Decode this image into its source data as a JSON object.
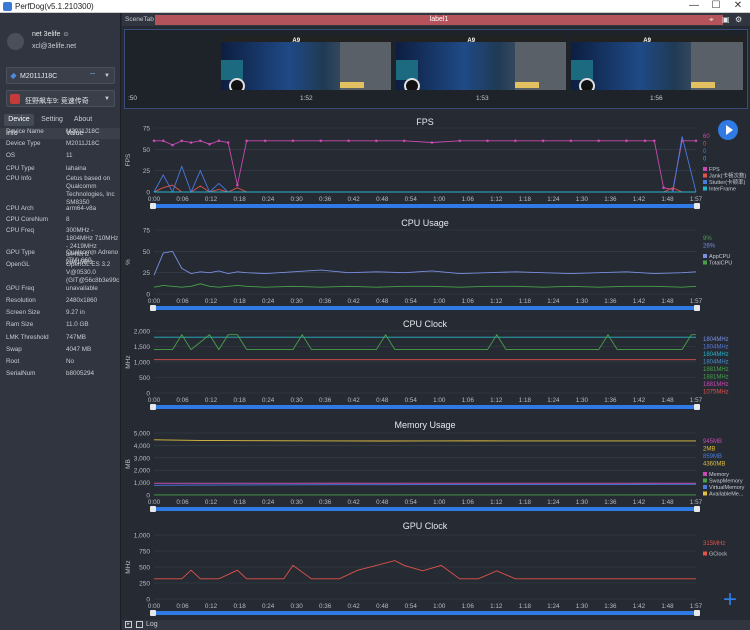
{
  "window": {
    "title": "PerfDog(v5.1.210300)",
    "minimize": "—",
    "maximize": "☐",
    "close": "✕"
  },
  "user": {
    "name": "net 3elife ☺",
    "email": "xcl@3elife.net"
  },
  "device_select": {
    "label": "M2011J18C",
    "wifi_icon": "wifi-icon"
  },
  "app_select": {
    "label": "狂野飙车9: 竞速传奇"
  },
  "tabs": [
    "Device",
    "Setting",
    "About"
  ],
  "info_header": {
    "key": "Info",
    "value": "Value"
  },
  "info_rows": [
    {
      "k": "Device Name",
      "v": "M2011J18C"
    },
    {
      "k": "Device Type",
      "v": "M2011J18C"
    },
    {
      "k": "OS",
      "v": "11"
    },
    {
      "k": "CPU Type",
      "v": "lahaina"
    },
    {
      "k": "CPU Info",
      "v": "Cetus based on Qualcomm Technologies, Inc SM8350"
    },
    {
      "k": "CPU Arch",
      "v": "arm64-v8a"
    },
    {
      "k": "CPU CoreNum",
      "v": "8"
    },
    {
      "k": "CPU Freq",
      "v": "300MHz - 1804MHz 710MHz - 2419MHz 844MHz - 2841MHz"
    },
    {
      "k": "GPU Type",
      "v": "Qualcomm Adreno (TM) 660"
    },
    {
      "k": "OpenGL",
      "v": "OpenGL ES 3.2 V@0530.0 (GIT@56c8b3e99c"
    },
    {
      "k": "GPU Freq",
      "v": "unavailable"
    },
    {
      "k": "Resolution",
      "v": "2480x1860"
    },
    {
      "k": "Screen Size",
      "v": "9.27 in"
    },
    {
      "k": "Ram Size",
      "v": "11.0 GB"
    },
    {
      "k": "LMK Threshold",
      "v": "747MB"
    },
    {
      "k": "Swap",
      "v": "4047 MB"
    },
    {
      "k": "Root",
      "v": "No"
    },
    {
      "k": "SerialNum",
      "v": "b8005294"
    }
  ],
  "scene": {
    "tab_label": "SceneTab",
    "label": "label1"
  },
  "thumb_ticks": [
    ":50",
    "1:52",
    "1:53",
    "1:56"
  ],
  "bottom": {
    "log_label": "Log"
  },
  "colors": {
    "fps": "#c94ab0",
    "jank": "#e2534a",
    "stutter": "#4a7ae0",
    "interframe": "#28b4c8",
    "app_cpu": "#7a8fe0",
    "total_cpu": "#4aa04a",
    "accent": "#2f7ae5"
  },
  "charts": [
    {
      "id": "fps",
      "title": "FPS",
      "ylabel": "FPS",
      "ymax": 75,
      "yticks": [
        0,
        25,
        50,
        75
      ],
      "xticks": [
        "0:00",
        "0:06",
        "0:12",
        "0:18",
        "0:24",
        "0:30",
        "0:36",
        "0:42",
        "0:48",
        "0:54",
        "1:00",
        "1:06",
        "1:12",
        "1:18",
        "1:24",
        "1:30",
        "1:36",
        "1:42",
        "1:48",
        "1:57"
      ],
      "legend_values": [
        {
          "text": "60",
          "color": "#c94ab0"
        },
        {
          "text": "0",
          "color": "#e2534a"
        },
        {
          "text": "0",
          "color": "#4a7ae0"
        },
        {
          "text": "0",
          "color": "#28b4c8"
        }
      ],
      "legend": [
        {
          "name": "FPS",
          "color": "#c94ab0"
        },
        {
          "name": "Jank(卡顿次数)",
          "color": "#e2534a"
        },
        {
          "name": "Stutter(卡顿率)",
          "color": "#4a7ae0"
        },
        {
          "name": "InterFrame",
          "color": "#28b4c8"
        }
      ]
    },
    {
      "id": "cpu",
      "title": "CPU Usage",
      "ylabel": "%",
      "ymax": 75,
      "yticks": [
        0,
        25,
        50,
        75
      ],
      "xticks": [
        "0:00",
        "0:06",
        "0:12",
        "0:18",
        "0:24",
        "0:30",
        "0:36",
        "0:42",
        "0:48",
        "0:54",
        "1:00",
        "1:06",
        "1:12",
        "1:18",
        "1:24",
        "1:30",
        "1:36",
        "1:42",
        "1:48",
        "1:57"
      ],
      "legend_values": [
        {
          "text": "9%",
          "color": "#4aa04a"
        },
        {
          "text": "26%",
          "color": "#7a8fe0"
        }
      ],
      "legend": [
        {
          "name": "AppCPU",
          "color": "#7a8fe0"
        },
        {
          "name": "TotalCPU",
          "color": "#4aa04a"
        }
      ]
    },
    {
      "id": "cpuclock",
      "title": "CPU Clock",
      "ylabel": "MHz",
      "ymax": 2000,
      "yticks": [
        0,
        500,
        1000,
        1500,
        2000
      ],
      "ytick_labels": [
        "0",
        "500",
        "1,000",
        "1,500",
        "2,000"
      ],
      "xticks": [
        "0:00",
        "0:06",
        "0:12",
        "0:18",
        "0:24",
        "0:30",
        "0:36",
        "0:42",
        "0:48",
        "0:54",
        "1:00",
        "1:06",
        "1:12",
        "1:18",
        "1:24",
        "1:30",
        "1:36",
        "1:42",
        "1:48",
        "1:57"
      ],
      "legend_values": [
        {
          "text": "1804MHz",
          "color": "#7a8fe0"
        },
        {
          "text": "1804MHz",
          "color": "#5a7ad4"
        },
        {
          "text": "1804MHz",
          "color": "#28b4c8"
        },
        {
          "text": "1804MHz",
          "color": "#4a90c8"
        },
        {
          "text": "1881MHz",
          "color": "#4aa04a"
        },
        {
          "text": "1881MHz",
          "color": "#4aa04a"
        },
        {
          "text": "1881MHz",
          "color": "#c94ab0"
        },
        {
          "text": "1075MHz",
          "color": "#e2534a"
        }
      ],
      "legend": []
    },
    {
      "id": "memory",
      "title": "Memory Usage",
      "ylabel": "MB",
      "ymax": 5000,
      "yticks": [
        0,
        1000,
        2000,
        3000,
        4000,
        5000
      ],
      "ytick_labels": [
        "0",
        "1,000",
        "2,000",
        "3,000",
        "4,000",
        "5,000"
      ],
      "xticks": [
        "0:00",
        "0:06",
        "0:12",
        "0:18",
        "0:24",
        "0:30",
        "0:36",
        "0:42",
        "0:48",
        "0:54",
        "1:00",
        "1:06",
        "1:12",
        "1:18",
        "1:24",
        "1:30",
        "1:36",
        "1:42",
        "1:48",
        "1:57"
      ],
      "legend_values": [
        {
          "text": "945MB",
          "color": "#c94ab0"
        },
        {
          "text": "2MB",
          "color": "#e2c040"
        },
        {
          "text": "859MB",
          "color": "#4a7ae0"
        },
        {
          "text": "4360MB",
          "color": "#e2c040"
        }
      ],
      "legend": [
        {
          "name": "Memory",
          "color": "#c94ab0"
        },
        {
          "name": "SwapMemory",
          "color": "#4aa04a"
        },
        {
          "name": "VirtualMemory",
          "color": "#4a7ae0"
        },
        {
          "name": "AvailableMe...",
          "color": "#e2c040"
        }
      ]
    },
    {
      "id": "gpu",
      "title": "GPU Clock",
      "ylabel": "MHz",
      "ymax": 1000,
      "yticks": [
        0,
        250,
        500,
        750,
        1000
      ],
      "ytick_labels": [
        "0",
        "250",
        "500",
        "750",
        "1,000"
      ],
      "xticks": [
        "0:00",
        "0:06",
        "0:12",
        "0:18",
        "0:24",
        "0:30",
        "0:36",
        "0:42",
        "0:48",
        "0:54",
        "1:00",
        "1:06",
        "1:12",
        "1:18",
        "1:24",
        "1:30",
        "1:36",
        "1:42",
        "1:48",
        "1:57"
      ],
      "legend_values": [
        {
          "text": "315MHz",
          "color": "#e2534a"
        }
      ],
      "legend": [
        {
          "name": "GClock",
          "color": "#e2534a"
        }
      ]
    }
  ],
  "chart_data": [
    {
      "type": "line",
      "title": "FPS",
      "ylabel": "FPS",
      "ylim": [
        0,
        75
      ],
      "grid": true,
      "x": [
        0,
        2,
        4,
        6,
        8,
        10,
        12,
        14,
        16,
        18,
        20,
        24,
        30,
        36,
        42,
        48,
        54,
        60,
        66,
        72,
        78,
        84,
        90,
        96,
        102,
        106,
        108,
        110,
        112,
        114,
        117
      ],
      "series": [
        {
          "name": "FPS",
          "values": [
            60,
            60,
            55,
            60,
            58,
            60,
            56,
            60,
            58,
            8,
            60,
            60,
            60,
            60,
            60,
            60,
            60,
            58,
            60,
            60,
            60,
            60,
            60,
            60,
            60,
            60,
            60,
            5,
            3,
            60,
            60
          ]
        },
        {
          "name": "Jank(卡顿次数)",
          "values": [
            0,
            5,
            8,
            0,
            0,
            7,
            0,
            3,
            0,
            5,
            0,
            0,
            0,
            0,
            0,
            0,
            0,
            0,
            0,
            0,
            0,
            0,
            0,
            0,
            0,
            0,
            0,
            0,
            5,
            0,
            0
          ]
        },
        {
          "name": "Stutter(卡顿率)",
          "values": [
            0,
            20,
            0,
            30,
            0,
            25,
            0,
            10,
            0,
            0,
            0,
            0,
            0,
            0,
            0,
            0,
            0,
            0,
            0,
            0,
            0,
            0,
            0,
            0,
            0,
            0,
            0,
            0,
            0,
            65,
            0
          ]
        },
        {
          "name": "InterFrame",
          "values": [
            0,
            0,
            0,
            0,
            0,
            0,
            0,
            0,
            0,
            0,
            0,
            0,
            0,
            0,
            0,
            0,
            0,
            0,
            0,
            0,
            0,
            0,
            0,
            0,
            0,
            0,
            0,
            0,
            0,
            0,
            0
          ]
        }
      ]
    },
    {
      "type": "line",
      "title": "CPU Usage",
      "ylabel": "%",
      "ylim": [
        0,
        75
      ],
      "grid": true,
      "x": [
        0,
        2,
        4,
        6,
        8,
        10,
        12,
        14,
        16,
        18,
        20,
        24,
        30,
        36,
        42,
        48,
        54,
        60,
        66,
        72,
        78,
        84,
        90,
        96,
        102,
        108,
        114,
        117
      ],
      "series": [
        {
          "name": "AppCPU",
          "values": [
            22,
            48,
            50,
            30,
            24,
            26,
            25,
            27,
            24,
            26,
            25,
            24,
            26,
            28,
            25,
            26,
            25,
            27,
            24,
            25,
            26,
            25,
            24,
            25,
            26,
            24,
            25,
            26
          ]
        },
        {
          "name": "TotalCPU",
          "values": [
            8,
            10,
            9,
            8,
            9,
            12,
            9,
            8,
            9,
            10,
            9,
            8,
            9,
            8,
            9,
            8,
            9,
            9,
            8,
            9,
            9,
            8,
            9,
            8,
            9,
            9,
            8,
            9
          ]
        }
      ]
    },
    {
      "type": "line",
      "title": "CPU Clock",
      "ylabel": "MHz",
      "ylim": [
        0,
        2000
      ],
      "grid": true,
      "x": [
        0,
        4,
        6,
        8,
        12,
        14,
        16,
        18,
        20,
        30,
        32,
        34,
        48,
        50,
        52,
        72,
        74,
        76,
        96,
        98,
        100,
        114,
        116,
        117
      ],
      "series": [
        {
          "name": "1804MHz",
          "values": [
            1800,
            1800,
            1800,
            1800,
            1800,
            1800,
            1800,
            1800,
            1800,
            1800,
            1800,
            1800,
            1800,
            1800,
            1800,
            1800,
            1800,
            1800,
            1800,
            1800,
            1800,
            1800,
            1800,
            1800
          ]
        },
        {
          "name": "1881MHz",
          "values": [
            1400,
            1400,
            1880,
            1400,
            1880,
            1400,
            1880,
            1880,
            1400,
            1400,
            1880,
            1400,
            1400,
            1880,
            1400,
            1400,
            1880,
            1400,
            1400,
            1880,
            1400,
            1400,
            1880,
            1880
          ]
        },
        {
          "name": "1075MHz",
          "values": [
            1075,
            1075,
            1075,
            1075,
            1075,
            1075,
            1075,
            1075,
            1075,
            1075,
            1075,
            1075,
            1075,
            1075,
            1075,
            1075,
            1075,
            1075,
            1075,
            1075,
            1075,
            1075,
            1075,
            1075
          ]
        }
      ]
    },
    {
      "type": "line",
      "title": "Memory Usage",
      "ylabel": "MB",
      "ylim": [
        0,
        5000
      ],
      "grid": true,
      "x": [
        0,
        10,
        20,
        30,
        40,
        50,
        60,
        70,
        80,
        90,
        100,
        110,
        117
      ],
      "series": [
        {
          "name": "Memory",
          "values": [
            945,
            945,
            940,
            945,
            948,
            945,
            943,
            945,
            946,
            945,
            944,
            945,
            945
          ]
        },
        {
          "name": "SwapMemory",
          "values": [
            2,
            2,
            2,
            2,
            2,
            2,
            2,
            2,
            2,
            2,
            2,
            2,
            2
          ]
        },
        {
          "name": "VirtualMemory",
          "values": [
            780,
            800,
            810,
            820,
            830,
            835,
            840,
            845,
            850,
            852,
            855,
            858,
            859
          ]
        },
        {
          "name": "AvailableMe...",
          "values": [
            4450,
            4400,
            4380,
            4370,
            4360,
            4355,
            4360,
            4365,
            4358,
            4360,
            4362,
            4360,
            4360
          ]
        }
      ]
    },
    {
      "type": "line",
      "title": "GPU Clock",
      "ylabel": "MHz",
      "ylim": [
        0,
        1000
      ],
      "grid": true,
      "x": [
        0,
        4,
        6,
        8,
        10,
        14,
        18,
        20,
        24,
        28,
        30,
        34,
        40,
        44,
        48,
        52,
        54,
        58,
        62,
        66,
        70,
        74,
        78,
        84,
        90,
        96,
        100,
        104,
        108,
        112,
        114,
        117
      ],
      "series": [
        {
          "name": "GClock",
          "values": [
            315,
            315,
            315,
            450,
            315,
            315,
            450,
            315,
            315,
            315,
            525,
            315,
            315,
            450,
            525,
            600,
            525,
            440,
            525,
            315,
            315,
            440,
            315,
            315,
            315,
            315,
            315,
            315,
            315,
            315,
            315,
            315
          ]
        }
      ]
    }
  ]
}
